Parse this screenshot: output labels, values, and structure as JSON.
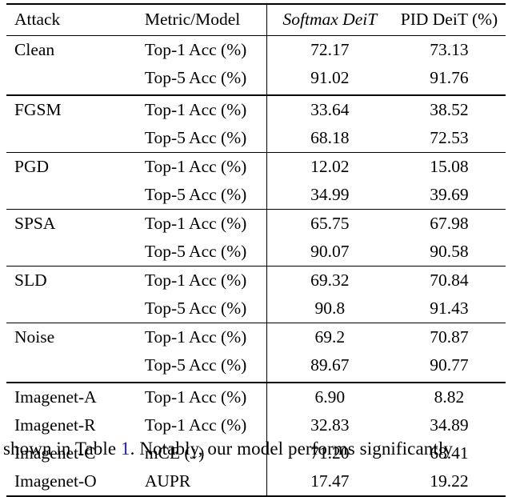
{
  "table": {
    "headers": {
      "attack": "Attack",
      "metric": "Metric/Model",
      "softmax": "Softmax DeiT",
      "pid": "PID DeiT (%)"
    },
    "groups": [
      {
        "name": "Clean",
        "rows": [
          {
            "label": "Clean",
            "metric": "Top-1 Acc (%)",
            "softmax": "72.17",
            "pid": "73.13"
          },
          {
            "label": "",
            "metric": "Top-5 Acc (%)",
            "softmax": "91.02",
            "pid": "91.76"
          }
        ]
      },
      {
        "name": "FGSM",
        "rows": [
          {
            "label": "FGSM",
            "metric": "Top-1 Acc (%)",
            "softmax": "33.64",
            "pid": "38.52"
          },
          {
            "label": "",
            "metric": "Top-5 Acc (%)",
            "softmax": "68.18",
            "pid": "72.53"
          }
        ]
      },
      {
        "name": "PGD",
        "rows": [
          {
            "label": "PGD",
            "metric": "Top-1 Acc (%)",
            "softmax": "12.02",
            "pid": "15.08"
          },
          {
            "label": "",
            "metric": "Top-5 Acc (%)",
            "softmax": "34.99",
            "pid": "39.69"
          }
        ]
      },
      {
        "name": "SPSA",
        "rows": [
          {
            "label": "SPSA",
            "metric": "Top-1 Acc (%)",
            "softmax": "65.75",
            "pid": "67.98"
          },
          {
            "label": "",
            "metric": "Top-5 Acc (%)",
            "softmax": "90.07",
            "pid": "90.58"
          }
        ]
      },
      {
        "name": "SLD",
        "rows": [
          {
            "label": "SLD",
            "metric": "Top-1 Acc (%)",
            "softmax": "69.32",
            "pid": "70.84"
          },
          {
            "label": "",
            "metric": "Top-5 Acc (%)",
            "softmax": "90.8",
            "pid": "91.43"
          }
        ]
      },
      {
        "name": "Noise",
        "rows": [
          {
            "label": "Noise",
            "metric": "Top-1 Acc (%)",
            "softmax": "69.2",
            "pid": "70.87"
          },
          {
            "label": "",
            "metric": "Top-5 Acc (%)",
            "softmax": "89.67",
            "pid": "90.77"
          }
        ]
      },
      {
        "name": "Imagenet",
        "rows": [
          {
            "label": "Imagenet-A",
            "metric": "Top-1 Acc (%)",
            "softmax": "6.90",
            "pid": "8.82"
          },
          {
            "label": "Imagenet-R",
            "metric": "Top-1 Acc (%)",
            "softmax": "32.83",
            "pid": "34.89"
          },
          {
            "label": "Imagenet-C",
            "metric": "mCE (↓)",
            "softmax": "71.20",
            "pid": "68.41"
          },
          {
            "label": "Imagenet-O",
            "metric": "AUPR",
            "softmax": "17.47",
            "pid": "19.22"
          }
        ]
      }
    ]
  },
  "caption": {
    "before": "shown in Table ",
    "reference": "1",
    "after": ". Notably, our model performs significantly"
  }
}
